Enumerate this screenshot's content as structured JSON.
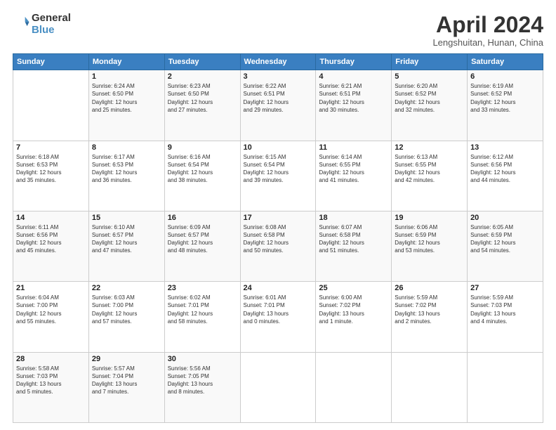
{
  "header": {
    "logo_line1": "General",
    "logo_line2": "Blue",
    "month_title": "April 2024",
    "subtitle": "Lengshuitan, Hunan, China"
  },
  "weekdays": [
    "Sunday",
    "Monday",
    "Tuesday",
    "Wednesday",
    "Thursday",
    "Friday",
    "Saturday"
  ],
  "weeks": [
    [
      {
        "day": "",
        "info": ""
      },
      {
        "day": "1",
        "info": "Sunrise: 6:24 AM\nSunset: 6:50 PM\nDaylight: 12 hours\nand 25 minutes."
      },
      {
        "day": "2",
        "info": "Sunrise: 6:23 AM\nSunset: 6:50 PM\nDaylight: 12 hours\nand 27 minutes."
      },
      {
        "day": "3",
        "info": "Sunrise: 6:22 AM\nSunset: 6:51 PM\nDaylight: 12 hours\nand 29 minutes."
      },
      {
        "day": "4",
        "info": "Sunrise: 6:21 AM\nSunset: 6:51 PM\nDaylight: 12 hours\nand 30 minutes."
      },
      {
        "day": "5",
        "info": "Sunrise: 6:20 AM\nSunset: 6:52 PM\nDaylight: 12 hours\nand 32 minutes."
      },
      {
        "day": "6",
        "info": "Sunrise: 6:19 AM\nSunset: 6:52 PM\nDaylight: 12 hours\nand 33 minutes."
      }
    ],
    [
      {
        "day": "7",
        "info": "Sunrise: 6:18 AM\nSunset: 6:53 PM\nDaylight: 12 hours\nand 35 minutes."
      },
      {
        "day": "8",
        "info": "Sunrise: 6:17 AM\nSunset: 6:53 PM\nDaylight: 12 hours\nand 36 minutes."
      },
      {
        "day": "9",
        "info": "Sunrise: 6:16 AM\nSunset: 6:54 PM\nDaylight: 12 hours\nand 38 minutes."
      },
      {
        "day": "10",
        "info": "Sunrise: 6:15 AM\nSunset: 6:54 PM\nDaylight: 12 hours\nand 39 minutes."
      },
      {
        "day": "11",
        "info": "Sunrise: 6:14 AM\nSunset: 6:55 PM\nDaylight: 12 hours\nand 41 minutes."
      },
      {
        "day": "12",
        "info": "Sunrise: 6:13 AM\nSunset: 6:55 PM\nDaylight: 12 hours\nand 42 minutes."
      },
      {
        "day": "13",
        "info": "Sunrise: 6:12 AM\nSunset: 6:56 PM\nDaylight: 12 hours\nand 44 minutes."
      }
    ],
    [
      {
        "day": "14",
        "info": "Sunrise: 6:11 AM\nSunset: 6:56 PM\nDaylight: 12 hours\nand 45 minutes."
      },
      {
        "day": "15",
        "info": "Sunrise: 6:10 AM\nSunset: 6:57 PM\nDaylight: 12 hours\nand 47 minutes."
      },
      {
        "day": "16",
        "info": "Sunrise: 6:09 AM\nSunset: 6:57 PM\nDaylight: 12 hours\nand 48 minutes."
      },
      {
        "day": "17",
        "info": "Sunrise: 6:08 AM\nSunset: 6:58 PM\nDaylight: 12 hours\nand 50 minutes."
      },
      {
        "day": "18",
        "info": "Sunrise: 6:07 AM\nSunset: 6:58 PM\nDaylight: 12 hours\nand 51 minutes."
      },
      {
        "day": "19",
        "info": "Sunrise: 6:06 AM\nSunset: 6:59 PM\nDaylight: 12 hours\nand 53 minutes."
      },
      {
        "day": "20",
        "info": "Sunrise: 6:05 AM\nSunset: 6:59 PM\nDaylight: 12 hours\nand 54 minutes."
      }
    ],
    [
      {
        "day": "21",
        "info": "Sunrise: 6:04 AM\nSunset: 7:00 PM\nDaylight: 12 hours\nand 55 minutes."
      },
      {
        "day": "22",
        "info": "Sunrise: 6:03 AM\nSunset: 7:00 PM\nDaylight: 12 hours\nand 57 minutes."
      },
      {
        "day": "23",
        "info": "Sunrise: 6:02 AM\nSunset: 7:01 PM\nDaylight: 12 hours\nand 58 minutes."
      },
      {
        "day": "24",
        "info": "Sunrise: 6:01 AM\nSunset: 7:01 PM\nDaylight: 13 hours\nand 0 minutes."
      },
      {
        "day": "25",
        "info": "Sunrise: 6:00 AM\nSunset: 7:02 PM\nDaylight: 13 hours\nand 1 minute."
      },
      {
        "day": "26",
        "info": "Sunrise: 5:59 AM\nSunset: 7:02 PM\nDaylight: 13 hours\nand 2 minutes."
      },
      {
        "day": "27",
        "info": "Sunrise: 5:59 AM\nSunset: 7:03 PM\nDaylight: 13 hours\nand 4 minutes."
      }
    ],
    [
      {
        "day": "28",
        "info": "Sunrise: 5:58 AM\nSunset: 7:03 PM\nDaylight: 13 hours\nand 5 minutes."
      },
      {
        "day": "29",
        "info": "Sunrise: 5:57 AM\nSunset: 7:04 PM\nDaylight: 13 hours\nand 7 minutes."
      },
      {
        "day": "30",
        "info": "Sunrise: 5:56 AM\nSunset: 7:05 PM\nDaylight: 13 hours\nand 8 minutes."
      },
      {
        "day": "",
        "info": ""
      },
      {
        "day": "",
        "info": ""
      },
      {
        "day": "",
        "info": ""
      },
      {
        "day": "",
        "info": ""
      }
    ]
  ]
}
